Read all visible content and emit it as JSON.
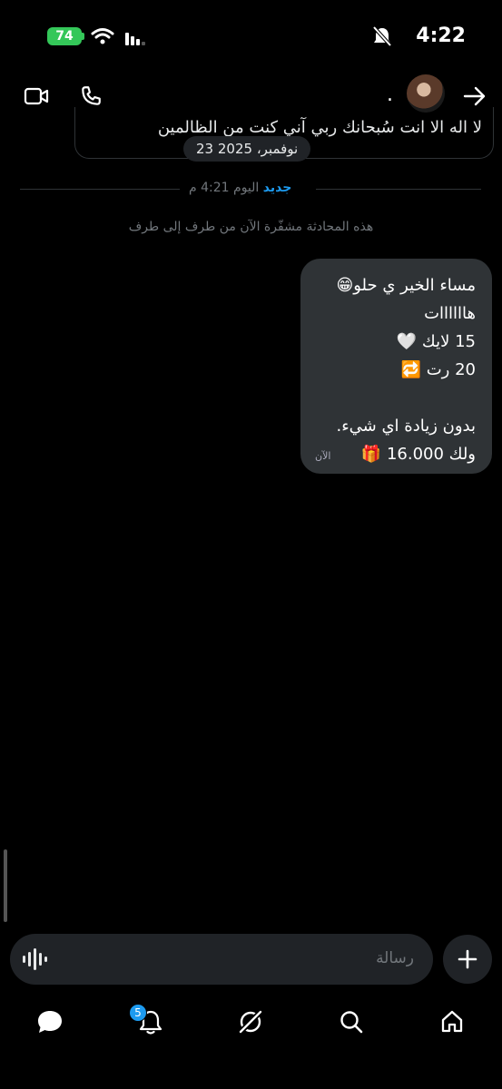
{
  "status_bar": {
    "battery": "74",
    "time": "4:22"
  },
  "header": {
    "name": "."
  },
  "previous_message": {
    "text": "لا اله الا انت سُبحانك ربي آني كنت من الظالمين",
    "date": "23 نوفمبر، 2025"
  },
  "divider": {
    "new_label": "جديد",
    "time_label": "اليوم 4:21 م"
  },
  "encryption_notice": "هذه المحادثة مشفّرة الآن من طرف إلى طرف",
  "message": {
    "lines": [
      "مساء الخير ي حلو😁",
      "هاااااات",
      "15 لايك 🤍",
      "20 رت 🔁",
      "",
      "بدون زيادة اي شيء.",
      "ولك 16.000 🎁"
    ],
    "time": "الآن"
  },
  "composer": {
    "placeholder": "رسالة"
  },
  "nav": {
    "notifications_count": "5"
  },
  "colors": {
    "accent": "#1d9bf0",
    "bubble": "#2f3336",
    "background": "#000000",
    "battery": "#34c759"
  }
}
